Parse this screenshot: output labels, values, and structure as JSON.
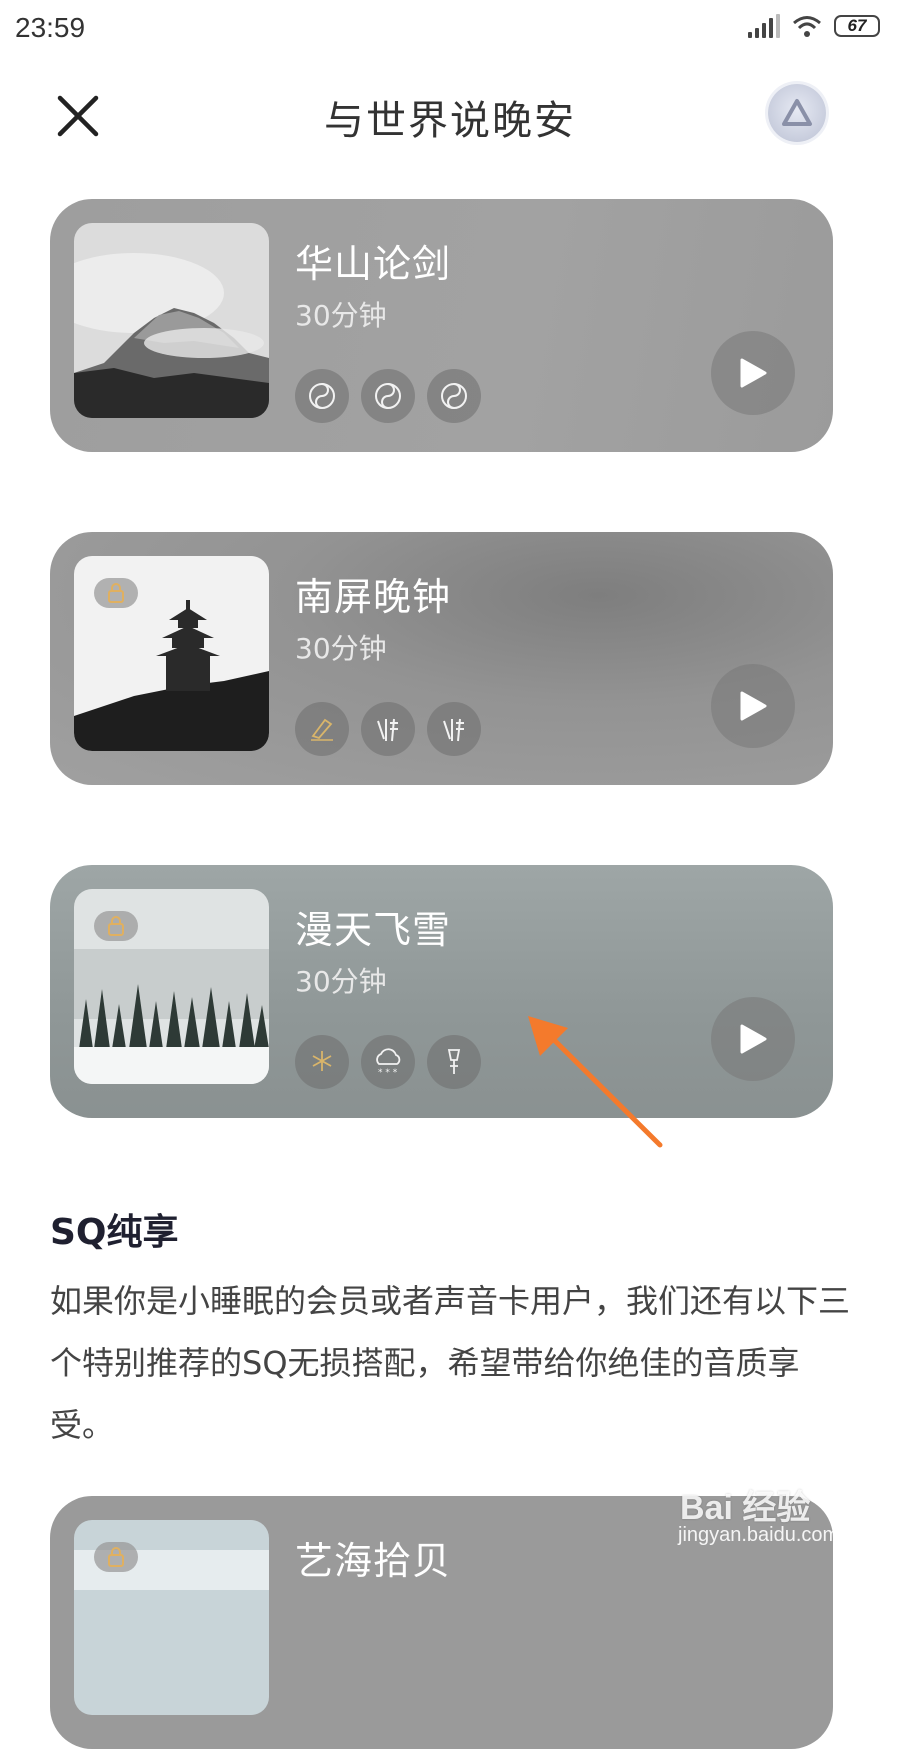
{
  "status_bar": {
    "time": "23:59",
    "battery": "67",
    "icons": [
      "signal-icon",
      "wifi-icon",
      "battery-icon"
    ]
  },
  "header": {
    "title": "与世界说晚安",
    "close_icon": "close-icon",
    "avatar_icon": "triangle-logo-icon"
  },
  "cards": [
    {
      "title": "华山论剑",
      "duration": "30分钟",
      "locked": false,
      "tags": [
        "yin-yang-iii-icon",
        "yin-yang-i-icon",
        "yin-yang-ii-icon"
      ]
    },
    {
      "title": "南屏晚钟",
      "duration": "30分钟",
      "locked": true,
      "tags": [
        "sq-bell-icon",
        "buddha-ii-icon",
        "buddha-icon"
      ]
    },
    {
      "title": "漫天飞雪",
      "duration": "30分钟",
      "locked": true,
      "tags": [
        "sq-snowflake-icon",
        "snow-cloud-icon",
        "chime-ii-icon"
      ]
    },
    {
      "title": "艺海拾贝",
      "locked": true
    }
  ],
  "sq_section": {
    "title": "SQ纯享",
    "description": "如果你是小睡眠的会员或者声音卡用户，我们还有以下三个特别推荐的SQ无损搭配，希望带给你绝佳的音质享受。"
  },
  "watermark": {
    "brand": "Bai 经验",
    "url": "jingyan.baidu.com"
  },
  "colors": {
    "accent_annotation": "#f47a2c",
    "card_text": "#ffffff",
    "title_text": "#333333"
  }
}
